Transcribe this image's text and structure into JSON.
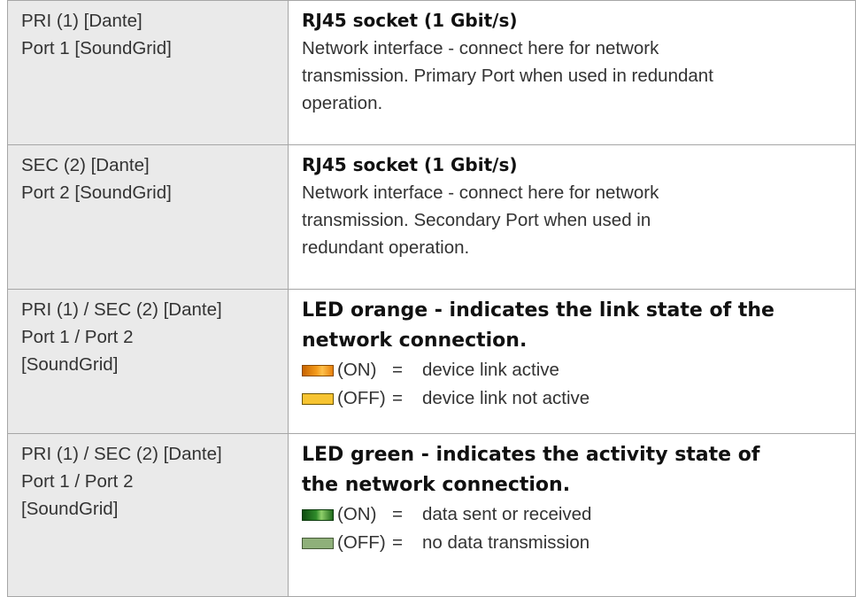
{
  "rows": [
    {
      "port": [
        "PRI (1) [Dante]",
        "Port 1 [SoundGrid]"
      ],
      "title": "RJ45 socket (1 Gbit/s)",
      "body": [
        "Network interface - connect here for network",
        "transmission. Primary Port when used in redundant",
        "operation."
      ]
    },
    {
      "port": [
        "SEC (2) [Dante]",
        "Port 2 [SoundGrid]"
      ],
      "title": "RJ45 socket (1 Gbit/s)",
      "body": [
        "Network interface - connect here for network",
        "transmission. Secondary Port when used in",
        "redundant operation."
      ]
    },
    {
      "port": [
        "PRI (1) / SEC (2) [Dante]",
        "Port 1 / Port 2",
        "[SoundGrid]"
      ],
      "title": [
        "LED orange - indicates the link state of the",
        "network connection."
      ],
      "states": [
        {
          "state": "(ON)",
          "eq": "=",
          "meaning": "device link active",
          "color": "#f39a1a"
        },
        {
          "state": "(OFF)",
          "eq": "=",
          "meaning": "device link not active",
          "color": "#f7c431"
        }
      ]
    },
    {
      "port": [
        "PRI (1) / SEC (2) [Dante]",
        "Port 1 / Port 2",
        "[SoundGrid]"
      ],
      "title": [
        "LED green - indicates the activity state of",
        "the network connection."
      ],
      "states": [
        {
          "state": "(ON)",
          "eq": "=",
          "meaning": "data sent or received",
          "color": "#2f8b2a"
        },
        {
          "state": "(OFF)",
          "eq": "=",
          "meaning": "no data transmission",
          "color": "#8fb07a"
        }
      ]
    }
  ]
}
